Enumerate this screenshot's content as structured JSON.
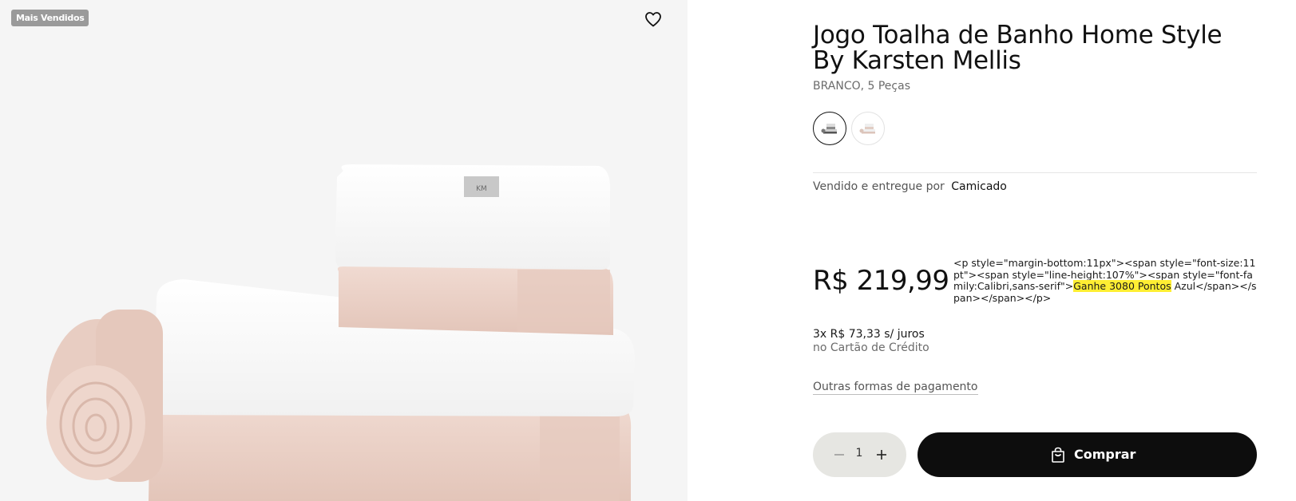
{
  "gallery": {
    "badge": "Mais Vendidos",
    "favorite_icon": "heart-outline-icon",
    "tag_text": "KM"
  },
  "product": {
    "title": "Jogo Toalha de Banho Home Style By Karsten Mellis",
    "subtitle": "BRANCO, 5 Peças",
    "swatches": [
      {
        "label": "towel-set-variant-1",
        "selected": true
      },
      {
        "label": "towel-set-variant-2",
        "selected": false
      }
    ]
  },
  "seller": {
    "prefix": "Vendido e entregue por",
    "name": "Camicado"
  },
  "price": {
    "value": "R$ 219,99",
    "raw_html_before": "<p style=\"margin-bottom:11px\"><span style=\"font-size:11pt\"><span style=\"line-height:107%\"><span style=\"font-family:Calibri,sans-serif\">",
    "raw_html_highlight": "Ganhe 3080 Pontos",
    "raw_html_after": " Azul</span></span></span></p>"
  },
  "installments": {
    "line1": "3x R$ 73,33 s/ juros",
    "line2": "no Cartão de Crédito"
  },
  "payment_link": "Outras formas de pagamento",
  "quantity": {
    "value": "1",
    "minus_icon": "minus-icon",
    "plus_icon": "plus-icon"
  },
  "buy": {
    "label": "Comprar",
    "icon": "shopping-bag-icon"
  },
  "colors": {
    "towel_white": "#f9f9f9",
    "towel_pink": "#e9cfc4",
    "buy_button": "#0d0d0d",
    "highlight": "#ffee33"
  }
}
